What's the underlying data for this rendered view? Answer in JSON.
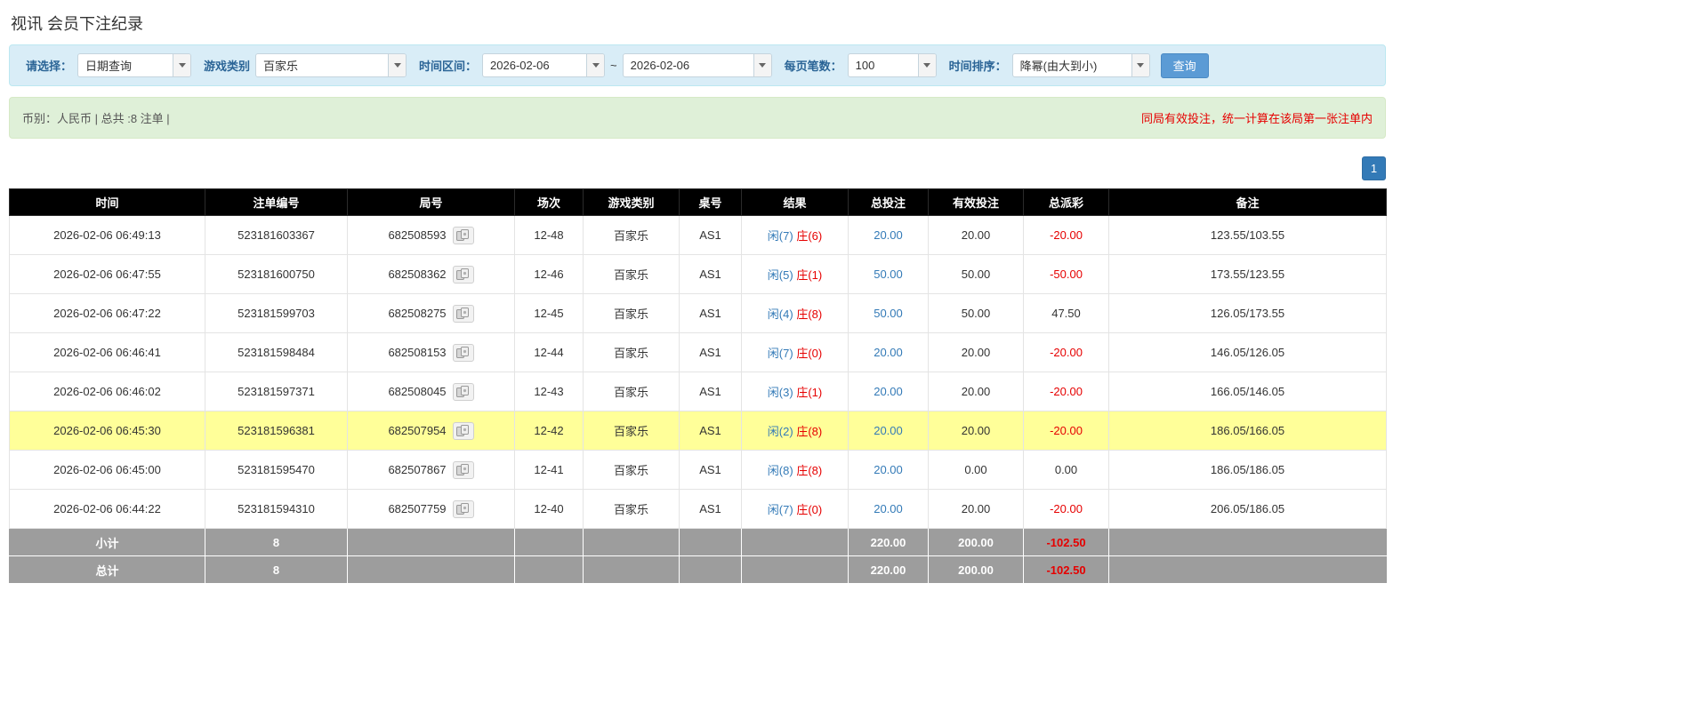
{
  "page": {
    "title": "视讯 会员下注纪录"
  },
  "filters": {
    "select_label": "请选择：",
    "select_value": "日期查询",
    "game_type_label": "游戏类别",
    "game_type_value": "百家乐",
    "time_range_label": "时间区间：",
    "date_from": "2026-02-06",
    "tilde": "~",
    "date_to": "2026-02-06",
    "page_size_label": "每页笔数：",
    "page_size_value": "100",
    "sort_label": "时间排序：",
    "sort_value": "降幂(由大到小)",
    "search_button": "查询"
  },
  "info_bar": {
    "left": "币别：人民币 | 总共 :8 注单 |",
    "right": "同局有效投注，统一计算在该局第一张注单内"
  },
  "pagination": {
    "current_page": "1"
  },
  "table": {
    "headers": [
      "时间",
      "注单编号",
      "局号",
      "场次",
      "游戏类别",
      "桌号",
      "结果",
      "总投注",
      "有效投注",
      "总派彩",
      "备注"
    ],
    "rows": [
      {
        "time": "2026-02-06 06:49:13",
        "bet_id": "523181603367",
        "round_id": "682508593",
        "session": "12-48",
        "game": "百家乐",
        "table_no": "AS1",
        "player": "闲(7)",
        "banker": "庄(6)",
        "total_bet": "20.00",
        "valid_bet": "20.00",
        "payout": "-20.00",
        "payout_red": true,
        "note": "123.55/103.55",
        "highlight": false
      },
      {
        "time": "2026-02-06 06:47:55",
        "bet_id": "523181600750",
        "round_id": "682508362",
        "session": "12-46",
        "game": "百家乐",
        "table_no": "AS1",
        "player": "闲(5)",
        "banker": "庄(1)",
        "total_bet": "50.00",
        "valid_bet": "50.00",
        "payout": "-50.00",
        "payout_red": true,
        "note": "173.55/123.55",
        "highlight": false
      },
      {
        "time": "2026-02-06 06:47:22",
        "bet_id": "523181599703",
        "round_id": "682508275",
        "session": "12-45",
        "game": "百家乐",
        "table_no": "AS1",
        "player": "闲(4)",
        "banker": "庄(8)",
        "total_bet": "50.00",
        "valid_bet": "50.00",
        "payout": "47.50",
        "payout_red": false,
        "note": "126.05/173.55",
        "highlight": false
      },
      {
        "time": "2026-02-06 06:46:41",
        "bet_id": "523181598484",
        "round_id": "682508153",
        "session": "12-44",
        "game": "百家乐",
        "table_no": "AS1",
        "player": "闲(7)",
        "banker": "庄(0)",
        "total_bet": "20.00",
        "valid_bet": "20.00",
        "payout": "-20.00",
        "payout_red": true,
        "note": "146.05/126.05",
        "highlight": false
      },
      {
        "time": "2026-02-06 06:46:02",
        "bet_id": "523181597371",
        "round_id": "682508045",
        "session": "12-43",
        "game": "百家乐",
        "table_no": "AS1",
        "player": "闲(3)",
        "banker": "庄(1)",
        "total_bet": "20.00",
        "valid_bet": "20.00",
        "payout": "-20.00",
        "payout_red": true,
        "note": "166.05/146.05",
        "highlight": false
      },
      {
        "time": "2026-02-06 06:45:30",
        "bet_id": "523181596381",
        "round_id": "682507954",
        "session": "12-42",
        "game": "百家乐",
        "table_no": "AS1",
        "player": "闲(2)",
        "banker": "庄(8)",
        "total_bet": "20.00",
        "valid_bet": "20.00",
        "payout": "-20.00",
        "payout_red": true,
        "note": "186.05/166.05",
        "highlight": true
      },
      {
        "time": "2026-02-06 06:45:00",
        "bet_id": "523181595470",
        "round_id": "682507867",
        "session": "12-41",
        "game": "百家乐",
        "table_no": "AS1",
        "player": "闲(8)",
        "banker": "庄(8)",
        "total_bet": "20.00",
        "valid_bet": "0.00",
        "payout": "0.00",
        "payout_red": false,
        "note": "186.05/186.05",
        "highlight": false
      },
      {
        "time": "2026-02-06 06:44:22",
        "bet_id": "523181594310",
        "round_id": "682507759",
        "session": "12-40",
        "game": "百家乐",
        "table_no": "AS1",
        "player": "闲(7)",
        "banker": "庄(0)",
        "total_bet": "20.00",
        "valid_bet": "20.00",
        "payout": "-20.00",
        "payout_red": true,
        "note": "206.05/186.05",
        "highlight": false
      }
    ],
    "subtotal": {
      "label": "小计",
      "count": "8",
      "total_bet": "220.00",
      "valid_bet": "200.00",
      "payout": "-102.50"
    },
    "total": {
      "label": "总计",
      "count": "8",
      "total_bet": "220.00",
      "valid_bet": "200.00",
      "payout": "-102.50"
    }
  }
}
